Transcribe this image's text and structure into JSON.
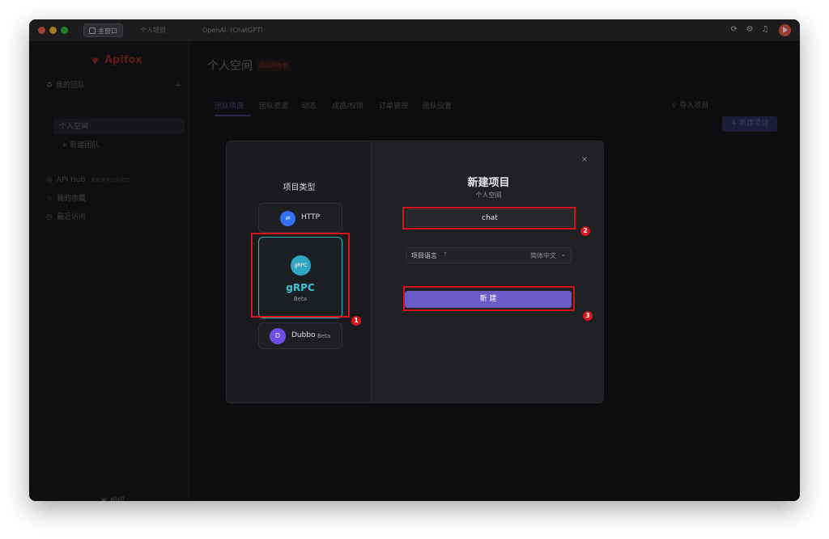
{
  "titlebar": {
    "tabs": [
      {
        "label": "主窗口"
      },
      {
        "label": "个人项目"
      },
      {
        "label": "OpenAI（ChatGPT）"
      }
    ],
    "icons": [
      "refresh-icon",
      "gear-icon",
      "bell-icon",
      "avatar"
    ]
  },
  "sidebar": {
    "brand": "Apifox",
    "my_team": "我的团队",
    "personal_space": "个人空间",
    "new_team": "+ 新建团队",
    "api_hub": "API Hub",
    "api_hub_desc": "发现更多公共接口",
    "favorites": "我的收藏",
    "recent": "最近访问",
    "org": "组织"
  },
  "main": {
    "title": "个人空间",
    "title_badge": "团队所有者",
    "tabs": [
      "团队项目",
      "团队资源",
      "动态",
      "成员/权限",
      "订单管理",
      "团队设置"
    ],
    "import": "导入项目",
    "new_project": "+ 新建项目"
  },
  "modal": {
    "type_title": "项目类型",
    "types": {
      "http": {
        "label": "HTTP",
        "icon_text": "⇄"
      },
      "grpc": {
        "label": "gRPC",
        "sub": "Beta",
        "icon_text": "gRPC"
      },
      "dubbo": {
        "label": "Dubbo",
        "sub": "Beta",
        "icon_text": "D"
      }
    },
    "title": "新建项目",
    "subtitle": "个人空间",
    "name_value": "chat",
    "lang_label": "项目语言",
    "lang_value": "简体中文",
    "create_label": "新 建",
    "close": "×"
  },
  "annotations": {
    "badge1": "1",
    "badge2": "2",
    "badge3": "3"
  },
  "colors": {
    "accent": "#6a5cc4",
    "highlight": "#d7131b",
    "grpc": "#3ec6db"
  }
}
